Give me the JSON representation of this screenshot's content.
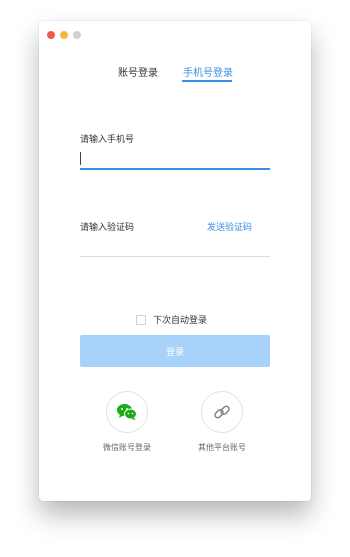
{
  "window": {
    "controls": [
      "close",
      "minimize",
      "maximize"
    ]
  },
  "tabs": [
    {
      "label": "账号登录",
      "active": false
    },
    {
      "label": "手机号登录",
      "active": true
    }
  ],
  "form": {
    "phone_label": "请输入手机号",
    "phone_value": "",
    "code_label": "请输入验证码",
    "code_value": "",
    "send_code_label": "发送验证码",
    "auto_login_label": "下次自动登录",
    "auto_login_checked": false,
    "login_button": "登录"
  },
  "social": {
    "wechat": {
      "label": "微信账号登录",
      "icon": "wechat-icon",
      "color": "#1aad19"
    },
    "other": {
      "label": "其他平台账号",
      "icon": "link-icon"
    }
  },
  "colors": {
    "accent": "#3a8ee6",
    "button_bg": "#a9d2fb",
    "text": "#333333",
    "muted": "#666666",
    "close": "#ee5a52",
    "minimize": "#f3b93a",
    "maximize": "#cfcfcf"
  }
}
